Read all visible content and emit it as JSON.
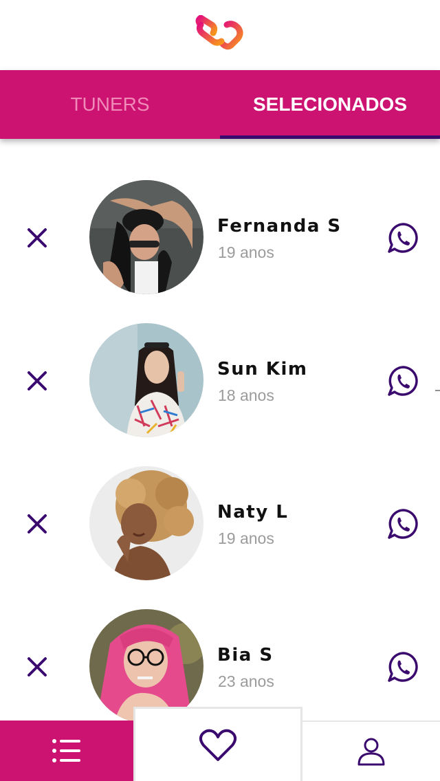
{
  "colors": {
    "primary": "#cd1372",
    "accent": "#3a0a6e",
    "tab_inactive": "#f08ab9",
    "age_text": "#9b9b9b"
  },
  "header": {
    "logo_icon": "link-logo-icon"
  },
  "tabs": [
    {
      "label": "TUNERS",
      "active": false
    },
    {
      "label": "SELECIONADOS",
      "active": true
    }
  ],
  "selected": [
    {
      "name": "Fernanda S",
      "age": "19 anos"
    },
    {
      "name": "Sun Kim",
      "age": "18 anos"
    },
    {
      "name": "Naty L",
      "age": "19 anos"
    },
    {
      "name": "Bia S",
      "age": "23 anos"
    }
  ],
  "row_icons": {
    "remove": "close-icon",
    "contact": "whatsapp-icon"
  },
  "bottom_nav": [
    {
      "icon": "list-icon"
    },
    {
      "icon": "heart-icon",
      "active": true
    },
    {
      "icon": "user-icon"
    }
  ]
}
